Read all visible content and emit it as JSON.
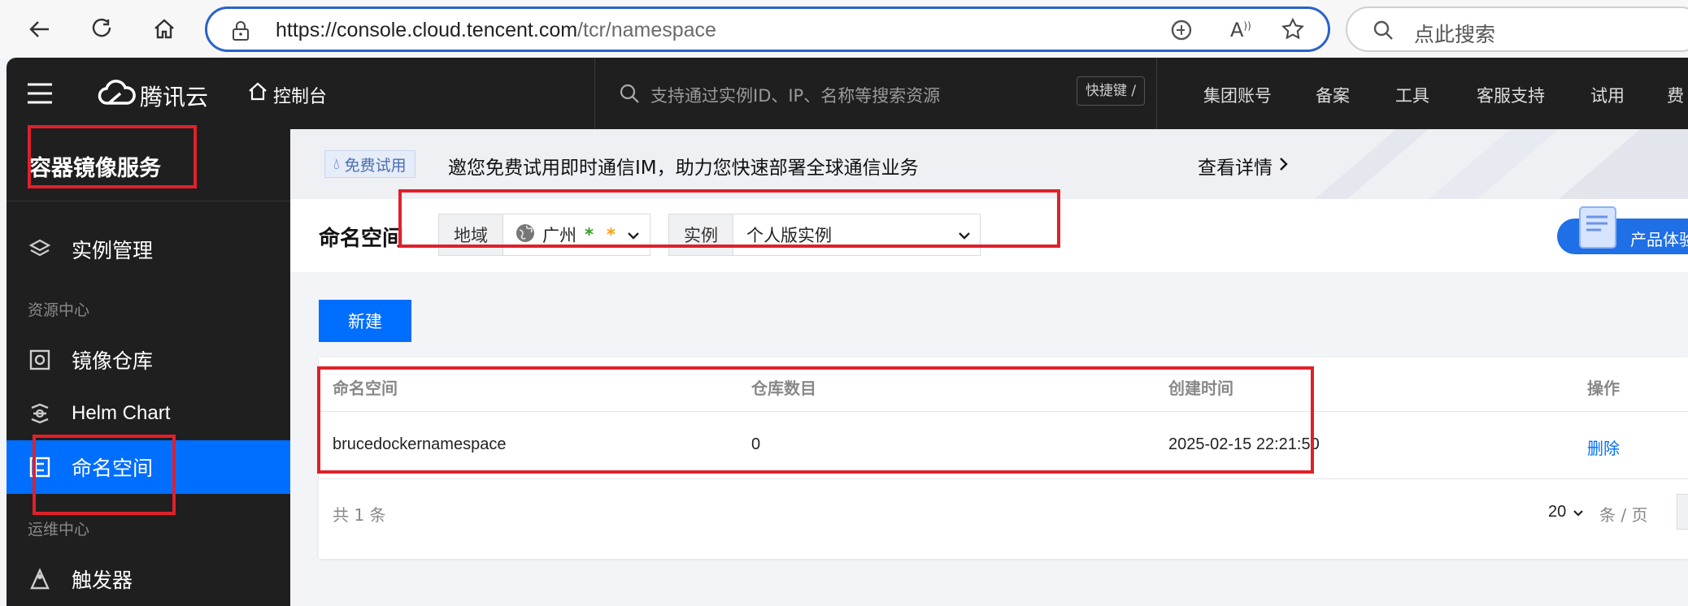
{
  "browser": {
    "url_host": "https://console.cloud.tencent.com",
    "url_path": "/tcr/namespace",
    "search_placeholder": "点此搜索"
  },
  "topbar": {
    "brand": "腾讯云",
    "console": "控制台",
    "search_placeholder": "支持通过实例ID、IP、名称等搜索资源",
    "shortcut": "快捷键 /",
    "links": [
      "集团账号",
      "备案",
      "工具",
      "客服支持",
      "试用",
      "费"
    ]
  },
  "sidebar": {
    "title": "容器镜像服务",
    "items": [
      {
        "label": "实例管理",
        "icon": "layers-icon"
      },
      {
        "label": "镜像仓库",
        "icon": "repository-icon"
      },
      {
        "label": "Helm Chart",
        "icon": "helm-icon"
      },
      {
        "label": "命名空间",
        "icon": "namespace-icon",
        "active": true
      },
      {
        "label": "触发器",
        "icon": "trigger-icon"
      }
    ],
    "sections": [
      "资源中心",
      "运维中心"
    ]
  },
  "banner": {
    "badge": "免费试用",
    "text": "邀您免费试用即时通信IM，助力您快速部署全球通信业务",
    "link": "查看详情"
  },
  "page": {
    "title": "命名空间",
    "region_label": "地域",
    "region_value": "广州",
    "instance_label": "实例",
    "instance_value": "个人版实例",
    "product_exp": "产品体验"
  },
  "actions": {
    "new": "新建"
  },
  "table": {
    "columns": [
      "命名空间",
      "仓库数目",
      "创建时间",
      "操作"
    ],
    "rows": [
      {
        "name": "brucedockernamespace",
        "repo_count": "0",
        "created": "2025-02-15 22:21:50",
        "action": "删除"
      }
    ],
    "total": "共 1 条",
    "page_size": "20",
    "per_page_unit": "条 / 页"
  },
  "colors": {
    "accent": "#006eff",
    "sidebar_bg": "#1f1f1f",
    "highlight_box": "#e0202a"
  }
}
